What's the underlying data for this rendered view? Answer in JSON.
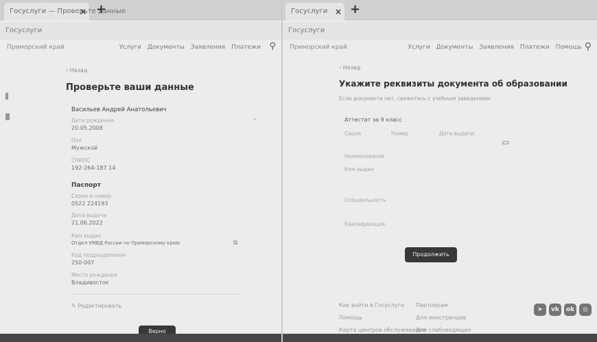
{
  "left": {
    "tab": {
      "title": "Госуслуги — Проверьте данные",
      "close": "×",
      "plus": "+"
    },
    "url": "Госуслуги",
    "nav": {
      "location": "Приморский край",
      "items": [
        "Услуги",
        "Документы",
        "Заявления",
        "Платежи",
        "Помощь"
      ]
    },
    "back": "‹ Назад",
    "heading": "Проверьте ваши данные",
    "person": "Васильев Андрей Анатольевич",
    "fields": [
      {
        "label": "Дата рождения",
        "value": "20.05.2008"
      },
      {
        "label": "Пол",
        "value": "Мужской"
      },
      {
        "label": "СНИЛС",
        "value": "192-264-187 14"
      }
    ],
    "passport_title": "Паспорт",
    "passport_fields": [
      {
        "label": "Серия и номер",
        "value": "0522 224193"
      },
      {
        "label": "Дата выдачи",
        "value": "21.06.2022"
      },
      {
        "label": "Кем выдан",
        "value": "Отдел УМВД России по Приморскому краю"
      },
      {
        "label": "Код подразделения",
        "value": "250-007"
      },
      {
        "label": "Место рождения",
        "value": "Владивосток"
      }
    ],
    "edit_link": "Редактировать",
    "bottom_button": "Верно"
  },
  "right": {
    "tab": {
      "title": "Госуслуги",
      "close": "×",
      "plus": "+"
    },
    "url": "Госуслуги",
    "nav": {
      "location": "Приморский край",
      "items": [
        "Услуги",
        "Документы",
        "Заявления",
        "Платежи",
        "Помощь"
      ]
    },
    "back": "‹ Назад",
    "heading": "Укажите реквизиты документа об образовании",
    "hint": "Если документа нет, свяжитесь с учебным заведением",
    "doc_type": "Аттестат за 9 класс",
    "col_headers": [
      "Серия",
      "Номер",
      "Дата выдачи"
    ],
    "fields": [
      "Наименование",
      "Кем выдан",
      "Специальность",
      "Квалификация"
    ],
    "continue_button": "Продолжить",
    "footer": {
      "col1": [
        "Как войти в Госуслуги",
        "Помощь",
        "Карта центров обслуживания"
      ],
      "col2": [
        "Партнерам",
        "Для иностранцев",
        "Для слабовидящих"
      ]
    },
    "social": [
      "Telegram",
      "VK",
      "OK",
      "Дзен"
    ]
  }
}
